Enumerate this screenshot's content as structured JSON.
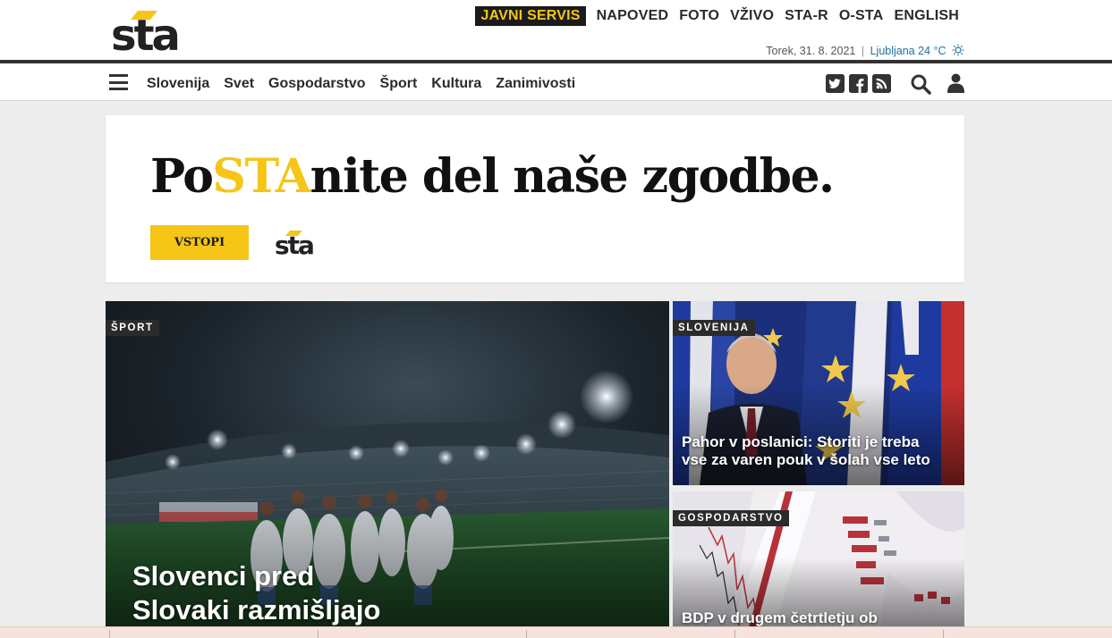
{
  "header": {
    "logo_text": "sta",
    "top_links": [
      "JAVNI SERVIS",
      "NAPOVED",
      "FOTO",
      "VŽIVO",
      "STA-R",
      "O-STA",
      "ENGLISH"
    ],
    "date": "Torek, 31. 8. 2021",
    "separator": "|",
    "weather": "Ljubljana 24 °C",
    "accent_color": "#f5c518"
  },
  "nav": {
    "menu_icon": "hamburger-icon",
    "items": [
      "Slovenija",
      "Svet",
      "Gospodarstvo",
      "Šport",
      "Kultura",
      "Zanimivosti"
    ],
    "social": [
      {
        "icon": "twitter-icon",
        "glyph": "t"
      },
      {
        "icon": "facebook-icon",
        "glyph": "f"
      },
      {
        "icon": "rss-icon",
        "glyph": ")"
      }
    ],
    "search_icon": "search-icon",
    "user_icon": "user-icon"
  },
  "promo": {
    "headline_before": "Po",
    "headline_highlight": "STA",
    "headline_after": "nite del naše zgodbe.",
    "button": "VSTOPI",
    "logo_text": "sta"
  },
  "cards": {
    "main": {
      "category": "ŠPORT",
      "title_line1": "Slovenci pred",
      "title_line2": "Slovaki razmišljajo"
    },
    "side1": {
      "category": "SLOVENIJA",
      "title_line1": "Pahor v poslanici: Storiti je treba",
      "title_line2": "vse za varen pouk v šolah vse leto"
    },
    "side2": {
      "category": "GOSPODARSTVO",
      "title_line1": "BDP v drugem četrtletju ob"
    }
  }
}
